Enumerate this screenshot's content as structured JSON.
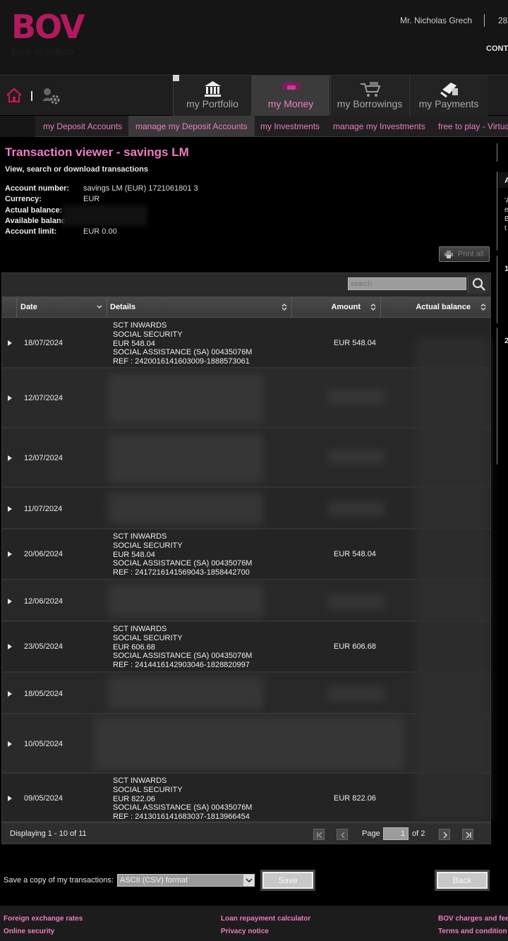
{
  "header": {
    "logo_text": "BOV",
    "logo_subtitle": "Bank of Valletta",
    "user_name": "Mr. Nicholas Grech",
    "user_extra": "28",
    "contact": "CONTA"
  },
  "main_nav": {
    "tabs": [
      {
        "label": "my Portfolio",
        "icon": "bank-icon",
        "active": false
      },
      {
        "label": "my Money",
        "icon": "wallet-icon",
        "active": true
      },
      {
        "label": "my Borrowings",
        "icon": "cart-icon",
        "active": false
      },
      {
        "label": "my Payments",
        "icon": "payments-icon",
        "active": false
      }
    ]
  },
  "sub_nav": {
    "items": [
      {
        "label": "my Deposit Accounts"
      },
      {
        "label": "manage my Deposit Accounts",
        "active": true
      },
      {
        "label": "my Investments"
      },
      {
        "label": "manage my Investments"
      },
      {
        "label": "free to play - Virtua"
      }
    ]
  },
  "page": {
    "title": "Transaction viewer - savings LM",
    "subtitle": "View, search or download transactions"
  },
  "account": {
    "fields": [
      {
        "label": "Account number:",
        "value": "savings LM (EUR) 1721061801 3"
      },
      {
        "label": "Currency:",
        "value": "EUR"
      },
      {
        "label": "Actual balance:",
        "value": ""
      },
      {
        "label": "Available balanc",
        "value": ""
      },
      {
        "label": "Account limit:",
        "value": "EUR 0.00"
      }
    ]
  },
  "print_all_label": "Print all",
  "search": {
    "placeholder": "search"
  },
  "grid": {
    "columns": [
      "Date",
      "Details",
      "Amount",
      "Actual balance"
    ],
    "rows": [
      {
        "date": "18/07/2024",
        "details": [
          "SCT INWARDS",
          "SOCIAL SECURITY",
          "EUR 548.04",
          "SOCIAL ASSISTANCE (SA) 00435076M",
          "REF : 2420016141603009-1888573061"
        ],
        "amount": "EUR 548.04"
      },
      {
        "date": "12/07/2024",
        "details": [],
        "amount": ""
      },
      {
        "date": "12/07/2024",
        "details": [],
        "amount": ""
      },
      {
        "date": "11/07/2024",
        "details": [],
        "amount": ""
      },
      {
        "date": "20/06/2024",
        "details": [
          "SCT INWARDS",
          "SOCIAL SECURITY",
          "EUR 548.04",
          "SOCIAL ASSISTANCE (SA) 00435076M",
          "REF : 2417216141569043-1858442700"
        ],
        "amount": "EUR 548.04"
      },
      {
        "date": "12/06/2024",
        "details": [],
        "amount": ""
      },
      {
        "date": "23/05/2024",
        "details": [
          "SCT INWARDS",
          "SOCIAL SECURITY",
          "EUR 606.68",
          "SOCIAL ASSISTANCE (SA) 00435076M",
          "REF : 2414416142903046-1828820997"
        ],
        "amount": "EUR 606.68"
      },
      {
        "date": "18/05/2024",
        "details": [],
        "amount": ""
      },
      {
        "date": "10/05/2024",
        "details": [],
        "amount": ""
      },
      {
        "date": "09/05/2024",
        "details": [
          "SCT INWARDS",
          "SOCIAL SECURITY",
          "EUR 822.06",
          "SOCIAL ASSISTANCE (SA) 00435076M",
          "REF : 2413016141683037-1813966454"
        ],
        "amount": "EUR 822.06"
      }
    ],
    "footer": {
      "displaying": "Displaying 1 - 10 of 11",
      "page_label": "Page",
      "current_page": "1",
      "of_pages": "of 2"
    }
  },
  "save": {
    "label": "Save a copy of my transactions:",
    "format": "ASCII (CSV) format",
    "save_button": "Save",
    "back_button": "Back"
  },
  "right_panels": [
    "A",
    "'A",
    "e",
    "B",
    "t",
    "1",
    "2"
  ],
  "footer_links": [
    "Foreign exchange rates",
    "Online security",
    "Loan repayment calculator",
    "Privacy notice",
    "BOV charges and fee",
    "Terms and condition"
  ],
  "colors": {
    "accent_pink": "#f07cc4",
    "brand": "#b3195e",
    "background": "#000000"
  }
}
